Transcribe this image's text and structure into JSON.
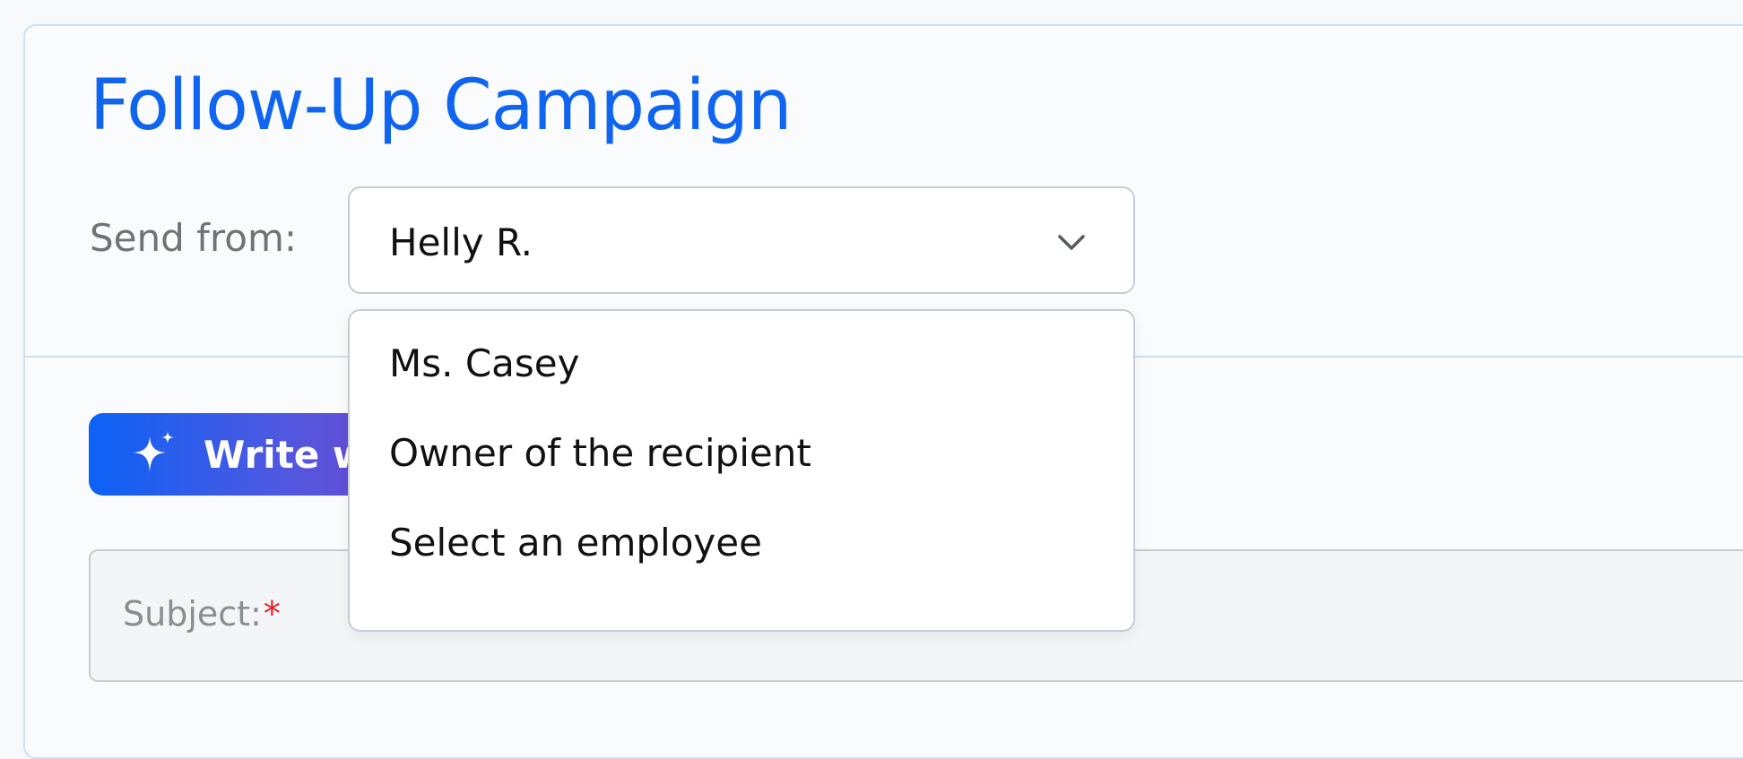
{
  "campaign": {
    "title": "Follow-Up Campaign"
  },
  "send_from": {
    "label": "Send from:",
    "selected": "Helly R.",
    "options": [
      "Ms. Casey",
      "Owner of the recipient",
      "Select an employee"
    ]
  },
  "ai_button": {
    "label": "Write w",
    "icon": "sparkle-icon"
  },
  "subject": {
    "label": "Subject:",
    "required_marker": "*"
  },
  "icons": {
    "dropdown_chevron": "chevron-down-icon"
  },
  "colors": {
    "title": "#1065f0",
    "gradient_start": "#0b62f5",
    "gradient_end": "#7a44c9",
    "required": "#e0202f",
    "border": "#cfe0ee"
  }
}
